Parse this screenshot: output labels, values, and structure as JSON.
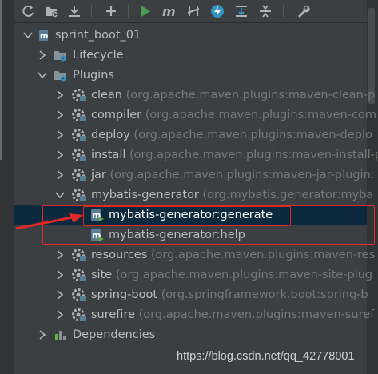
{
  "toolbar": {
    "buttons": [
      "reimport-icon",
      "generate-sources-icon",
      "download-icon",
      "add-icon",
      "run-icon",
      "maven-goal-icon",
      "toggle-offline-icon",
      "skip-tests-icon",
      "show-dependencies-icon",
      "collapse-all-icon",
      "settings-icon"
    ]
  },
  "tree": {
    "root": "sprint_boot_01",
    "lifecycle": "Lifecycle",
    "plugins": "Plugins",
    "plugin_items": [
      {
        "name": "clean",
        "detail": "(org.apache.maven.plugins:maven-clean-p"
      },
      {
        "name": "compiler",
        "detail": "(org.apache.maven.plugins:maven-com"
      },
      {
        "name": "deploy",
        "detail": "(org.apache.maven.plugins:maven-deplo"
      },
      {
        "name": "install",
        "detail": "(org.apache.maven.plugins:maven-install-p"
      },
      {
        "name": "jar",
        "detail": "(org.apache.maven.plugins:maven-jar-plugin:"
      },
      {
        "name": "mybatis-generator",
        "detail": "(org.mybatis.generator:myba"
      },
      {
        "name": "resources",
        "detail": "(org.apache.maven.plugins:maven-res"
      },
      {
        "name": "site",
        "detail": "(org.apache.maven.plugins:maven-site-plug"
      },
      {
        "name": "spring-boot",
        "detail": "(org.springframework.boot:spring-b"
      },
      {
        "name": "surefire",
        "detail": "(org.apache.maven.plugins:maven-suref"
      }
    ],
    "goals": [
      "mybatis-generator:generate",
      "mybatis-generator:help"
    ],
    "dependencies": "Dependencies"
  },
  "watermark": "https://blog.csdn.net/qq_42778001",
  "colors": {
    "background": "#3c3f41",
    "selection": "#0d293e",
    "annotation": "#e02a2a"
  }
}
